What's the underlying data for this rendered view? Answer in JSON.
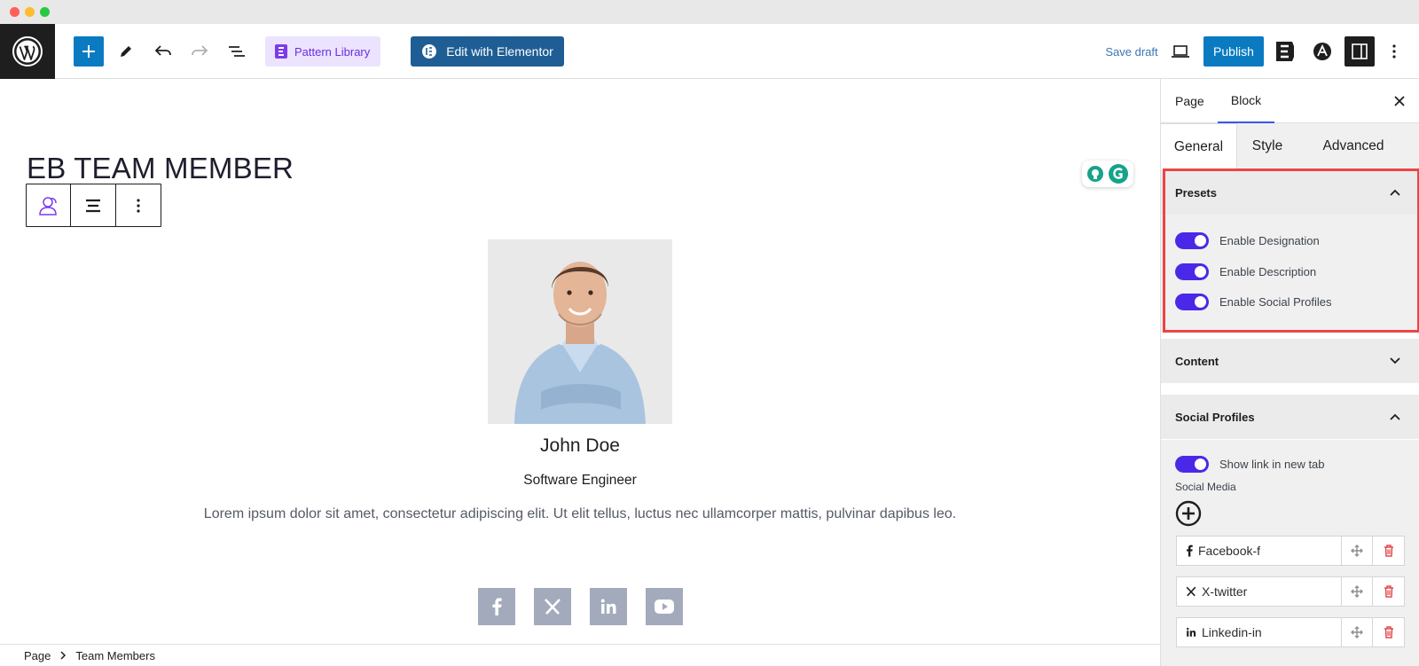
{
  "toolbar": {
    "pattern_library_label": "Pattern Library",
    "edit_elementor_label": "Edit with Elementor",
    "save_draft_label": "Save draft",
    "publish_label": "Publish"
  },
  "canvas": {
    "page_title": "EB TEAM MEMBER",
    "member": {
      "name": "John Doe",
      "designation": "Software Engineer",
      "description": "Lorem ipsum dolor sit amet, consectetur adipiscing elit. Ut elit tellus, luctus nec ullamcorper mattis, pulvinar dapibus leo."
    },
    "social_icons": [
      "facebook-icon",
      "x-twitter-icon",
      "linkedin-icon",
      "youtube-icon"
    ]
  },
  "breadcrumb": {
    "items": [
      "Page",
      "Team Members"
    ]
  },
  "sidebar": {
    "tabs": [
      "Page",
      "Block"
    ],
    "active_tab": "Block",
    "subtabs": [
      "General",
      "Style",
      "Advanced"
    ],
    "active_subtab": "General",
    "presets": {
      "title": "Presets",
      "toggles": [
        {
          "label": "Enable Designation",
          "on": true
        },
        {
          "label": "Enable Description",
          "on": true
        },
        {
          "label": "Enable Social Profiles",
          "on": true
        }
      ]
    },
    "content": {
      "title": "Content"
    },
    "social_profiles": {
      "title": "Social Profiles",
      "new_tab_label": "Show link in new tab",
      "new_tab_on": true,
      "social_media_label": "Social Media",
      "items": [
        "Facebook-f",
        "X-twitter",
        "Linkedin-in"
      ]
    }
  },
  "colors": {
    "wp_blue": "#0a7bc1",
    "toggle_accent": "#4b28e8",
    "highlight_red": "#ef4444",
    "social_icon_bg": "#a3aabc"
  }
}
